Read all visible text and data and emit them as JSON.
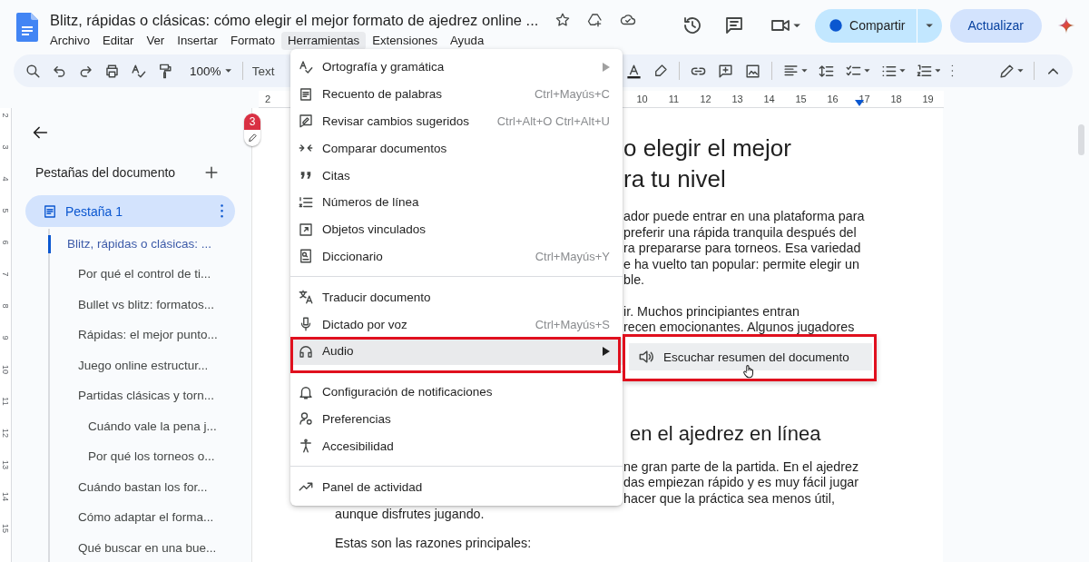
{
  "header": {
    "title": "Blitz, rápidas o clásicas: cómo elegir el mejor formato de ajedrez online ...",
    "menus": [
      {
        "label": "Archivo",
        "selected": false
      },
      {
        "label": "Editar",
        "selected": false
      },
      {
        "label": "Ver",
        "selected": false
      },
      {
        "label": "Insertar",
        "selected": false
      },
      {
        "label": "Formato",
        "selected": false
      },
      {
        "label": "Herramientas",
        "selected": true
      },
      {
        "label": "Extensiones",
        "selected": false
      },
      {
        "label": "Ayuda",
        "selected": false
      }
    ],
    "share_button": "Compartir",
    "update_button": "Actualizar"
  },
  "toolbar": {
    "zoom": "100%",
    "style": "Text"
  },
  "ruler": {
    "left_labels": [
      "2"
    ],
    "right_labels": [
      "10",
      "11",
      "12",
      "13",
      "14",
      "15",
      "16",
      "17",
      "18",
      "19"
    ]
  },
  "vertical_ruler": [
    "2",
    "3",
    "4",
    "5",
    "6",
    "7",
    "8",
    "9",
    "10",
    "11",
    "12",
    "13",
    "14",
    "15"
  ],
  "sidebar": {
    "heading": "Pestañas del documento",
    "tabs": [
      {
        "label": "Pestaña 1",
        "selected": true
      }
    ],
    "outline": [
      {
        "label": "Blitz, rápidas o clásicas: ...",
        "selected": true,
        "children": [
          {
            "label": "Por qué el control de ti...",
            "selected": false
          },
          {
            "label": "Bullet vs blitz: formatos...",
            "selected": false
          },
          {
            "label": "Rápidas: el mejor punto...",
            "selected": false
          },
          {
            "label": "Juego online estructur...",
            "selected": false
          },
          {
            "label": "Partidas clásicas y torn...",
            "selected": false,
            "children": [
              {
                "label": "Cuándo vale la pena j...",
                "selected": false
              },
              {
                "label": "Por qué los torneos o...",
                "selected": false
              }
            ]
          },
          {
            "label": "Cuándo bastan los for...",
            "selected": false
          },
          {
            "label": "Cómo adaptar el forma...",
            "selected": false
          },
          {
            "label": "Qué buscar en una bue...",
            "selected": false
          }
        ]
      }
    ]
  },
  "comments_badge": "3",
  "document": {
    "heading_1": [
      "o elegir el mejor",
      "ra tu nivel"
    ],
    "paragraph_1": [
      "ador puede entrar en una plataforma para",
      "preferir una rápida tranquila después del",
      "ra prepararse para torneos. Esa variedad",
      "e ha vuelto tan popular: permite elegir un",
      "ble."
    ],
    "paragraph_2": [
      "ir. Muchos principiantes entran",
      "recen emocionantes. Algunos jugadores"
    ],
    "heading_2": "en el ajedrez en línea",
    "paragraph_3": [
      "ne gran parte de la partida. En el ajedrez",
      "das empiezan rápido y es muy fácil jugar",
      "hacer que la práctica sea menos útil,"
    ],
    "lower_lines": [
      "aunque disfrutes jugando.",
      "Estas son las razones principales:"
    ]
  },
  "tools_menu": {
    "groups": [
      [
        {
          "label": "Ortografía y gramática",
          "submenu": true,
          "selected": false,
          "annotated": false
        },
        {
          "label": "Recuento de palabras",
          "shortcut": "Ctrl+Mayús+C",
          "submenu": false,
          "selected": false,
          "annotated": false
        },
        {
          "label": "Revisar cambios sugeridos",
          "shortcut": "Ctrl+Alt+O Ctrl+Alt+U",
          "submenu": false,
          "selected": false,
          "annotated": false
        },
        {
          "label": "Comparar documentos",
          "submenu": false,
          "selected": false,
          "annotated": false
        },
        {
          "label": "Citas",
          "submenu": false,
          "selected": false,
          "annotated": false
        },
        {
          "label": "Números de línea",
          "submenu": false,
          "selected": false,
          "annotated": false
        },
        {
          "label": "Objetos vinculados",
          "submenu": false,
          "selected": false,
          "annotated": false
        },
        {
          "label": "Diccionario",
          "shortcut": "Ctrl+Mayús+Y",
          "submenu": false,
          "selected": false,
          "annotated": false
        }
      ],
      [
        {
          "label": "Traducir documento",
          "submenu": false,
          "selected": false,
          "annotated": false
        },
        {
          "label": "Dictado por voz",
          "shortcut": "Ctrl+Mayús+S",
          "submenu": false,
          "selected": false,
          "annotated": false
        },
        {
          "label": "Audio",
          "submenu": true,
          "selected": true,
          "annotated": true
        }
      ],
      [
        {
          "label": "Configuración de notificaciones",
          "submenu": false,
          "selected": false,
          "annotated": false
        },
        {
          "label": "Preferencias",
          "submenu": false,
          "selected": false,
          "annotated": false
        },
        {
          "label": "Accesibilidad",
          "submenu": false,
          "selected": false,
          "annotated": false
        }
      ],
      [
        {
          "label": "Panel de actividad",
          "submenu": false,
          "selected": false,
          "annotated": false
        }
      ]
    ]
  },
  "audio_submenu": [
    {
      "label": "Escuchar resumen del documento",
      "selected": true,
      "annotated": true
    }
  ]
}
